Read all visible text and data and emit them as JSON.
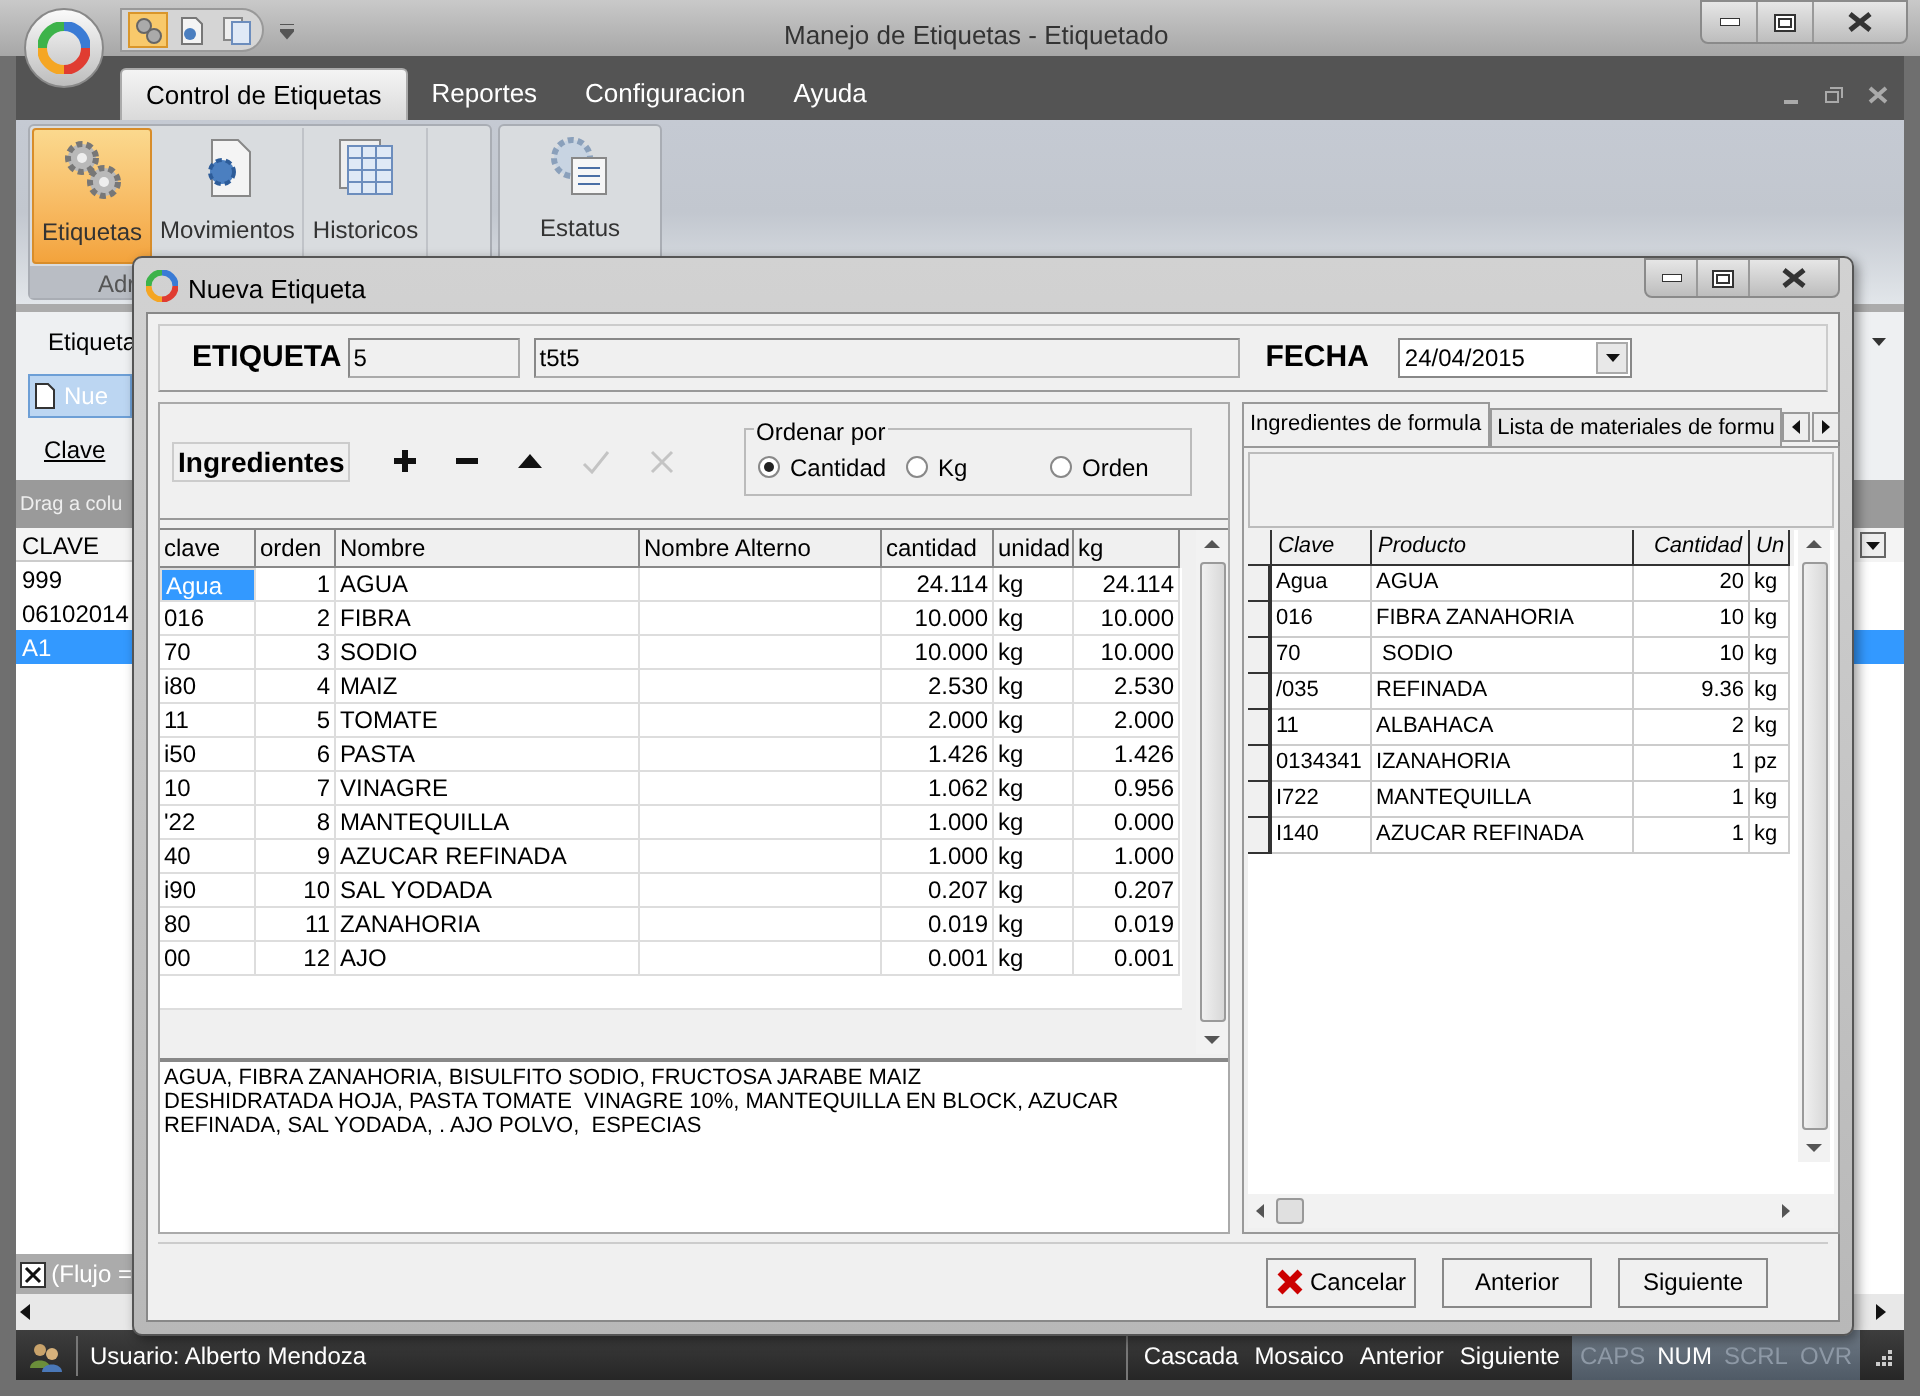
{
  "window": {
    "title": "Manejo de Etiquetas - Etiquetado"
  },
  "ribbon": {
    "tabs": [
      {
        "label": "Control de Etiquetas",
        "selected": true
      },
      {
        "label": "Reportes",
        "selected": false
      },
      {
        "label": "Configuracion",
        "selected": false
      },
      {
        "label": "Ayuda",
        "selected": false
      }
    ],
    "buttons": [
      {
        "label": "Etiquetas",
        "kind": "gears",
        "selected": true
      },
      {
        "label": "Movimientos",
        "kind": "document",
        "selected": false
      },
      {
        "label": "Historicos",
        "kind": "sheets",
        "selected": false
      },
      {
        "label": "Estatus",
        "kind": "status",
        "selected": false
      }
    ],
    "group_label": "Adr"
  },
  "background": {
    "toolbar_label": "Etiqueta",
    "new_button": "Nue",
    "clave_label": "Clave",
    "drag_hint": "Drag a colu",
    "grid_header": "CLAVE",
    "rows": [
      {
        "text": "999",
        "selected": false
      },
      {
        "text": "06102014",
        "selected": false
      },
      {
        "text": "A1",
        "selected": true
      }
    ],
    "filter": "(Flujo ="
  },
  "dialog": {
    "title": "Nueva Etiqueta",
    "etiqueta_label": "ETIQUETA",
    "etiqueta_code": "5",
    "etiqueta_name": "t5t5",
    "fecha_label": "FECHA",
    "fecha": "24/04/2015",
    "ingredientes_label": "Ingredientes",
    "tools": [
      {
        "kind": "add",
        "disabled": false
      },
      {
        "kind": "remove",
        "disabled": false
      },
      {
        "kind": "up",
        "disabled": false
      },
      {
        "kind": "check",
        "disabled": true
      },
      {
        "kind": "cancel",
        "disabled": true
      }
    ],
    "sort": {
      "legend": "Ordenar por",
      "options": [
        {
          "label": "Cantidad",
          "selected": true
        },
        {
          "label": "Kg",
          "selected": false
        },
        {
          "label": "Orden",
          "selected": false
        }
      ]
    },
    "columns": [
      "clave",
      "orden",
      "Nombre",
      "Nombre Alterno",
      "cantidad",
      "unidad",
      "kg"
    ],
    "rows": [
      {
        "cells": [
          "Agua",
          "1",
          "AGUA",
          "",
          "24.114",
          "kg",
          "24.114"
        ],
        "selected": true
      },
      {
        "cells": [
          "016",
          "2",
          "FIBRA",
          "",
          "10.000",
          "kg",
          "10.000"
        ],
        "selected": false
      },
      {
        "cells": [
          "70",
          "3",
          "SODIO",
          "",
          "10.000",
          "kg",
          "10.000"
        ],
        "selected": false
      },
      {
        "cells": [
          "i80",
          "4",
          "MAIZ",
          "",
          "2.530",
          "kg",
          "2.530"
        ],
        "selected": false
      },
      {
        "cells": [
          "11",
          "5",
          "TOMATE",
          "",
          "2.000",
          "kg",
          "2.000"
        ],
        "selected": false
      },
      {
        "cells": [
          "i50",
          "6",
          "PASTA",
          "",
          "1.426",
          "kg",
          "1.426"
        ],
        "selected": false
      },
      {
        "cells": [
          "10",
          "7",
          "VINAGRE",
          "",
          "1.062",
          "kg",
          "0.956"
        ],
        "selected": false
      },
      {
        "cells": [
          "'22",
          "8",
          "MANTEQUILLA",
          "",
          "1.000",
          "kg",
          "0.000"
        ],
        "selected": false
      },
      {
        "cells": [
          "40",
          "9",
          "AZUCAR REFINADA",
          "",
          "1.000",
          "kg",
          "1.000"
        ],
        "selected": false
      },
      {
        "cells": [
          "i90",
          "10",
          "SAL YODADA",
          "",
          "0.207",
          "kg",
          "0.207"
        ],
        "selected": false
      },
      {
        "cells": [
          "80",
          "11",
          "ZANAHORIA",
          "",
          "0.019",
          "kg",
          "0.019"
        ],
        "selected": false
      },
      {
        "cells": [
          "00",
          "12",
          "AJO",
          "",
          "0.001",
          "kg",
          "0.001"
        ],
        "selected": false
      }
    ],
    "declaration": [
      "AGUA, FIBRA ZANAHORIA, BISULFITO SODIO, FRUCTOSA JARABE MAIZ",
      "DESHIDRATADA HOJA, PASTA TOMATE  VINAGRE 10%, MANTEQUILLA EN BLOCK, AZUCAR",
      "REFINADA, SAL YODADA, . AJO POLVO,  ESPECIAS"
    ],
    "formula_tabs": [
      {
        "label": "Ingredientes de formula",
        "selected": true
      },
      {
        "label": "Lista de materiales de formu",
        "selected": false
      }
    ],
    "formula_columns": [
      "Clave",
      "Producto",
      "Cantidad",
      "Un"
    ],
    "formula_rows": [
      [
        "Agua",
        "AGUA",
        "20",
        "kg"
      ],
      [
        "016",
        "FIBRA ZANAHORIA",
        "10",
        "kg"
      ],
      [
        "70",
        " SODIO",
        "10",
        "kg"
      ],
      [
        "/035",
        "REFINADA",
        "9.36",
        "kg"
      ],
      [
        "11",
        "ALBAHACA",
        "2",
        "kg"
      ],
      [
        "0134341",
        "IZANAHORIA",
        "1",
        "pz"
      ],
      [
        "I722",
        "MANTEQUILLA",
        "1",
        "kg"
      ],
      [
        "I140",
        "AZUCAR REFINADA",
        "1",
        "kg"
      ]
    ],
    "buttons": [
      {
        "label": "Cancelar",
        "kind": "cancel"
      },
      {
        "label": "Anterior",
        "kind": "plain"
      },
      {
        "label": "Siguiente",
        "kind": "plain"
      }
    ]
  },
  "status_bar": {
    "user": "Usuario: Alberto Mendoza",
    "links": [
      "Cascada",
      "Mosaico",
      "Anterior",
      "Siguiente"
    ],
    "indicators": [
      {
        "label": "CAPS",
        "on": false
      },
      {
        "label": "NUM",
        "on": true
      },
      {
        "label": "SCRL",
        "on": false
      },
      {
        "label": "OVR",
        "on": false
      }
    ]
  }
}
